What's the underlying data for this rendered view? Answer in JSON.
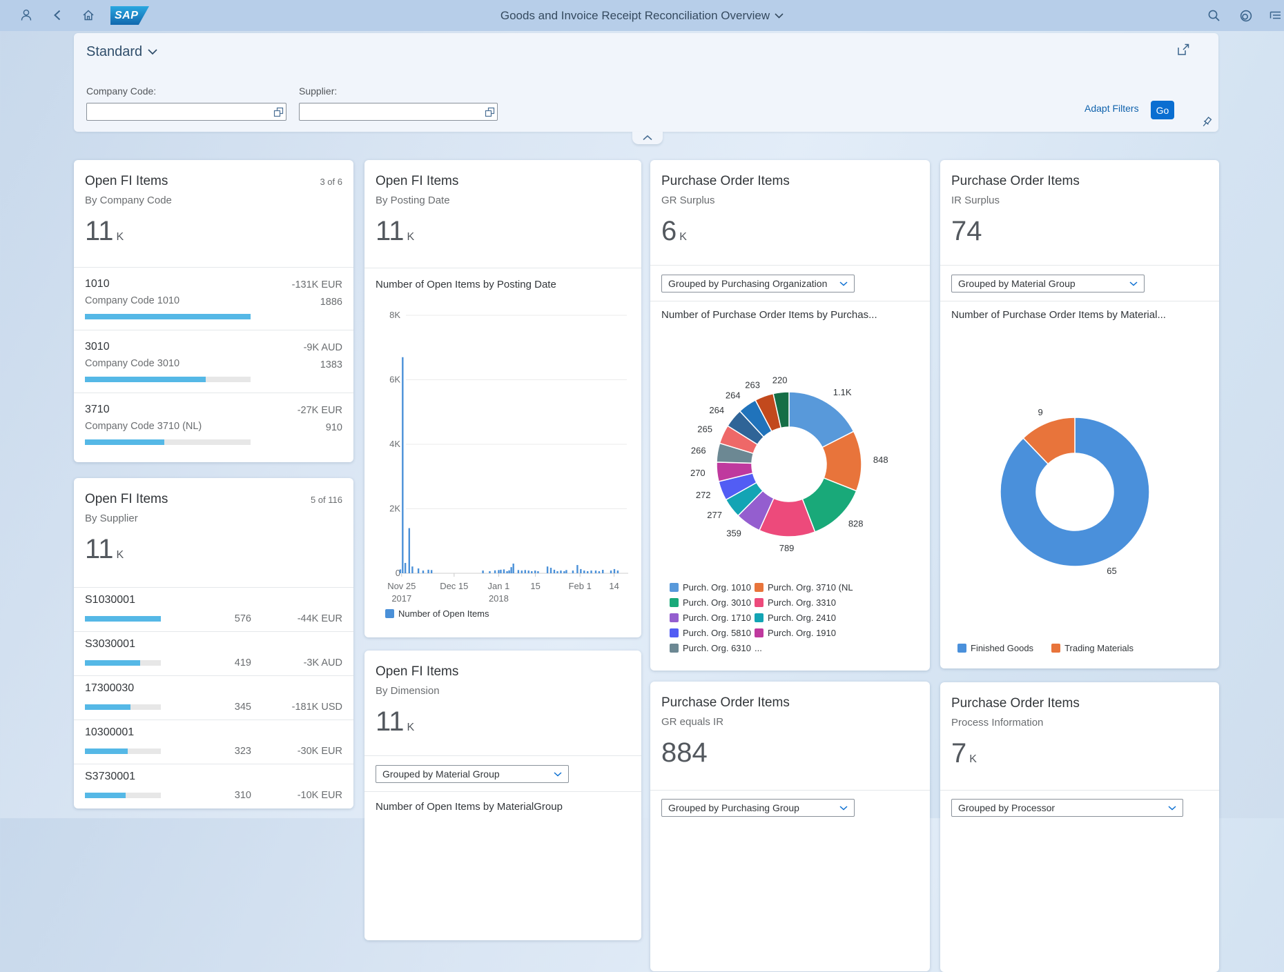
{
  "shell": {
    "title": "Goods and Invoice Receipt Reconciliation Overview",
    "logo": "SAP"
  },
  "filter_bar": {
    "variant_title": "Standard",
    "company_code_label": "Company Code:",
    "company_code_value": "",
    "supplier_label": "Supplier:",
    "supplier_value": "",
    "adapt_filters_label": "Adapt Filters",
    "go_label": "Go"
  },
  "cards": {
    "company_code": {
      "title": "Open FI Items",
      "subtitle": "By Company Code",
      "counter": "3 of 6",
      "kpi": "11",
      "kpi_unit": "K",
      "items": [
        {
          "code": "1010",
          "name": "Company Code 1010",
          "amount": "-131K EUR",
          "count": "1886",
          "pct": 100
        },
        {
          "code": "3010",
          "name": "Company Code 3010",
          "amount": "-9K AUD",
          "count": "1383",
          "pct": 73
        },
        {
          "code": "3710",
          "name": "Company Code 3710 (NL)",
          "amount": "-27K EUR",
          "count": "910",
          "pct": 48
        }
      ]
    },
    "supplier": {
      "title": "Open FI Items",
      "subtitle": "By Supplier",
      "counter": "5 of 116",
      "kpi": "11",
      "kpi_unit": "K",
      "items": [
        {
          "code": "S1030001",
          "count": "576",
          "amount": "-44K EUR",
          "pct": 100
        },
        {
          "code": "S3030001",
          "count": "419",
          "amount": "-3K AUD",
          "pct": 73
        },
        {
          "code": "17300030",
          "count": "345",
          "amount": "-181K USD",
          "pct": 60
        },
        {
          "code": "10300001",
          "count": "323",
          "amount": "-30K EUR",
          "pct": 56
        },
        {
          "code": "S3730001",
          "count": "310",
          "amount": "-10K EUR",
          "pct": 54
        }
      ]
    },
    "posting_date": {
      "title": "Open FI Items",
      "subtitle": "By Posting Date",
      "kpi": "11",
      "kpi_unit": "K"
    },
    "dimension": {
      "title": "Open FI Items",
      "subtitle": "By Dimension",
      "kpi": "11",
      "kpi_unit": "K",
      "dropdown": "Grouped by Material Group",
      "chart_title": "Number of Open Items by MaterialGroup"
    },
    "gr_surplus": {
      "title": "Purchase Order Items",
      "subtitle": "GR Surplus",
      "kpi": "6",
      "kpi_unit": "K",
      "dropdown": "Grouped by Purchasing Organization"
    },
    "ir_surplus": {
      "title": "Purchase Order Items",
      "subtitle": "IR Surplus",
      "kpi": "74",
      "kpi_unit": "",
      "dropdown": "Grouped by Material Group"
    },
    "gr_equals_ir": {
      "title": "Purchase Order Items",
      "subtitle": "GR equals IR",
      "kpi": "884",
      "kpi_unit": "",
      "dropdown": "Grouped by Purchasing Group"
    },
    "process_info": {
      "title": "Purchase Order Items",
      "subtitle": "Process Information",
      "kpi": "7",
      "kpi_unit": "K",
      "dropdown": "Grouped by Processor"
    }
  },
  "chart_data": [
    {
      "type": "bar",
      "card": "open-fi-items-by-posting-date",
      "title": "Number of Open Items by Posting Date",
      "series": [
        {
          "name": "Number of Open Items",
          "color": "#4A90D8"
        }
      ],
      "x_axis": {
        "start_date": "2017-11-24",
        "ticks": [
          {
            "day": 1,
            "label": "Nov 25",
            "sub": "2017"
          },
          {
            "day": 21,
            "label": "Dec 15",
            "sub": ""
          },
          {
            "day": 38,
            "label": "Jan 1",
            "sub": "2018"
          },
          {
            "day": 52,
            "label": "15",
            "sub": ""
          },
          {
            "day": 69,
            "label": "Feb 1",
            "sub": ""
          },
          {
            "day": 82,
            "label": "14",
            "sub": ""
          }
        ]
      },
      "y_axis": {
        "min": 0,
        "max": 8000,
        "ticks": [
          {
            "v": 8000,
            "label": "8K"
          },
          {
            "v": 6000,
            "label": "6K"
          },
          {
            "v": 4000,
            "label": "4K"
          },
          {
            "v": 2000,
            "label": "2K"
          },
          {
            "v": 0,
            "label": "0"
          }
        ]
      },
      "bars": [
        [
          0.5,
          120
        ],
        [
          1.4,
          6700
        ],
        [
          2.4,
          320
        ],
        [
          3.9,
          1400
        ],
        [
          5.1,
          210
        ],
        [
          7.4,
          150
        ],
        [
          9.2,
          85
        ],
        [
          11.2,
          110
        ],
        [
          12.4,
          100
        ],
        [
          32,
          85
        ],
        [
          34.6,
          64
        ],
        [
          36.6,
          90
        ],
        [
          38,
          100
        ],
        [
          38.8,
          110
        ],
        [
          40,
          120
        ],
        [
          41.2,
          64
        ],
        [
          42,
          90
        ],
        [
          42.8,
          190
        ],
        [
          43.6,
          300
        ],
        [
          45.5,
          100
        ],
        [
          46.8,
          85
        ],
        [
          48.1,
          100
        ],
        [
          49.4,
          85
        ],
        [
          50.6,
          64
        ],
        [
          51.9,
          85
        ],
        [
          53,
          64
        ],
        [
          56.6,
          210
        ],
        [
          57.9,
          170
        ],
        [
          59.2,
          110
        ],
        [
          60.4,
          64
        ],
        [
          61.7,
          85
        ],
        [
          63,
          64
        ],
        [
          63.8,
          100
        ],
        [
          66.3,
          85
        ],
        [
          68,
          255
        ],
        [
          69.3,
          130
        ],
        [
          70.6,
          85
        ],
        [
          71.9,
          64
        ],
        [
          73.3,
          85
        ],
        [
          75,
          85
        ],
        [
          76.3,
          64
        ],
        [
          77.7,
          107
        ],
        [
          80.8,
          85
        ],
        [
          82.1,
          130
        ],
        [
          83.4,
          85
        ]
      ]
    },
    {
      "type": "donut",
      "card": "purchase-order-items-gr-surplus",
      "title": "Number of Purchase Order Items by Purchas...",
      "slices": [
        {
          "label": "1.1K",
          "value": 1100,
          "color": "#5899DA"
        },
        {
          "label": "848",
          "value": 848,
          "color": "#E8743B"
        },
        {
          "label": "828",
          "value": 828,
          "color": "#19A979"
        },
        {
          "label": "789",
          "value": 789,
          "color": "#ED4A7B"
        },
        {
          "label": "359",
          "value": 359,
          "color": "#945ECF"
        },
        {
          "label": "277",
          "value": 277,
          "color": "#13A4B4"
        },
        {
          "label": "272",
          "value": 272,
          "color": "#525DF4"
        },
        {
          "label": "270",
          "value": 270,
          "color": "#BF399E"
        },
        {
          "label": "266",
          "value": 266,
          "color": "#6C8893"
        },
        {
          "label": "265",
          "value": 265,
          "color": "#EE6868"
        },
        {
          "label": "264",
          "value": 264,
          "color": "#2F6497"
        },
        {
          "label": "264",
          "value": 264,
          "color": "#2073BB"
        },
        {
          "label": "263",
          "value": 263,
          "color": "#C2491D"
        },
        {
          "label": "220",
          "value": 220,
          "color": "#156E46"
        }
      ],
      "legend": [
        {
          "label": "Purch. Org. 1010",
          "color": "#5899DA"
        },
        {
          "label": "Purch. Org. 3710 (NL",
          "color": "#E8743B"
        },
        {
          "label": "Purch. Org. 3010",
          "color": "#19A979"
        },
        {
          "label": "Purch. Org. 3310",
          "color": "#ED4A7B"
        },
        {
          "label": "Purch. Org. 1710",
          "color": "#945ECF"
        },
        {
          "label": "Purch. Org. 2410",
          "color": "#13A4B4"
        },
        {
          "label": "Purch. Org. 5810",
          "color": "#525DF4"
        },
        {
          "label": "Purch. Org. 1910",
          "color": "#BF399E"
        },
        {
          "label": "Purch. Org. 6310",
          "color": "#6C8893"
        },
        {
          "label": "...",
          "color": null
        }
      ]
    },
    {
      "type": "donut",
      "card": "purchase-order-items-ir-surplus",
      "title": "Number of Purchase Order Items by Material...",
      "slices": [
        {
          "label": "65",
          "value": 65,
          "color": "#4A90DB"
        },
        {
          "label": "9",
          "value": 9,
          "color": "#E8743B"
        }
      ],
      "legend": [
        {
          "label": "Finished Goods",
          "color": "#4A90DB"
        },
        {
          "label": "Trading Materials",
          "color": "#E8743B"
        }
      ]
    }
  ],
  "icons": [
    "person-icon",
    "back-icon",
    "home-icon",
    "sap-logo",
    "search-icon",
    "copilot-icon",
    "overflow-icon",
    "share-icon",
    "chevron-down-icon",
    "chevron-up-icon",
    "value-help-icon",
    "pin-icon"
  ]
}
